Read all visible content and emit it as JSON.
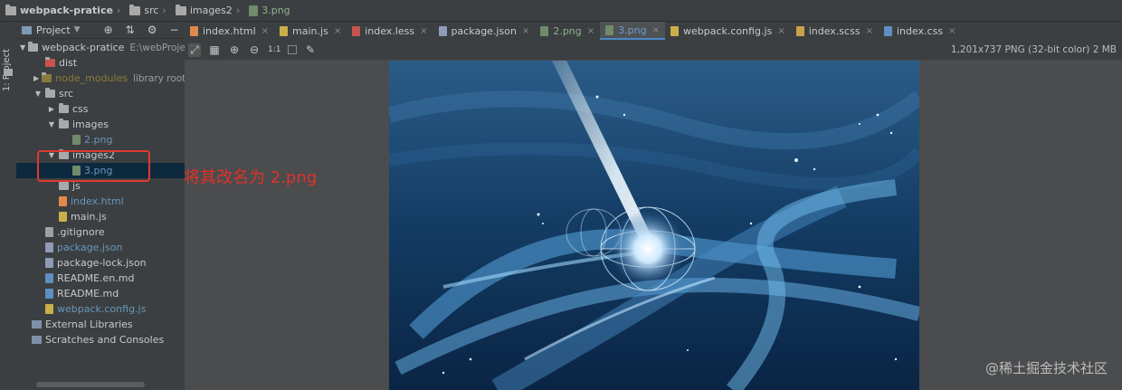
{
  "breadcrumb": [
    {
      "icon": "folder-icon",
      "label": "webpack-pratice"
    },
    {
      "icon": "folder-icon",
      "label": "src"
    },
    {
      "icon": "folder-icon",
      "label": "images2"
    },
    {
      "icon": "png-file-icon",
      "label": "3.png"
    }
  ],
  "project_panel": {
    "title": "Project",
    "strip_label": "1: Project"
  },
  "tree": [
    {
      "indent": 0,
      "arrow": "▼",
      "icon": "folder",
      "label": "webpack-pratice",
      "extra": "E:\\webProject\\"
    },
    {
      "indent": 1,
      "arrow": "",
      "icon": "folder-red",
      "label": "dist"
    },
    {
      "indent": 1,
      "arrow": "▶",
      "icon": "folder-olive",
      "label": "node_modules",
      "extra": "library root"
    },
    {
      "indent": 1,
      "arrow": "▼",
      "icon": "folder",
      "label": "src"
    },
    {
      "indent": 2,
      "arrow": "▶",
      "icon": "folder",
      "label": "css"
    },
    {
      "indent": 2,
      "arrow": "▼",
      "icon": "folder",
      "label": "images"
    },
    {
      "indent": 3,
      "arrow": "",
      "icon": "png",
      "label": "2.png"
    },
    {
      "indent": 2,
      "arrow": "▼",
      "icon": "folder",
      "label": "images2"
    },
    {
      "indent": 3,
      "arrow": "",
      "icon": "png",
      "label": "3.png",
      "selected": true
    },
    {
      "indent": 2,
      "arrow": "",
      "icon": "folder",
      "label": "js"
    },
    {
      "indent": 2,
      "arrow": "",
      "icon": "html",
      "label": "index.html"
    },
    {
      "indent": 2,
      "arrow": "",
      "icon": "js",
      "label": "main.js"
    },
    {
      "indent": 1,
      "arrow": "",
      "icon": "git",
      "label": ".gitignore"
    },
    {
      "indent": 1,
      "arrow": "",
      "icon": "json",
      "label": "package.json"
    },
    {
      "indent": 1,
      "arrow": "",
      "icon": "json",
      "label": "package-lock.json"
    },
    {
      "indent": 1,
      "arrow": "",
      "icon": "md",
      "label": "README.en.md"
    },
    {
      "indent": 1,
      "arrow": "",
      "icon": "md",
      "label": "README.md"
    },
    {
      "indent": 1,
      "arrow": "",
      "icon": "js",
      "label": "webpack.config.js"
    },
    {
      "indent": 0,
      "arrow": "",
      "icon": "lib",
      "label": "External Libraries"
    },
    {
      "indent": 0,
      "arrow": "",
      "icon": "lib",
      "label": "Scratches and Consoles"
    }
  ],
  "tabs": [
    {
      "label": "index.html",
      "icon": "html"
    },
    {
      "label": "main.js",
      "icon": "js"
    },
    {
      "label": "index.less",
      "icon": "less"
    },
    {
      "label": "package.json",
      "icon": "json"
    },
    {
      "label": "2.png",
      "icon": "png"
    },
    {
      "label": "3.png",
      "icon": "png",
      "active": true
    },
    {
      "label": "webpack.config.js",
      "icon": "js"
    },
    {
      "label": "index.scss",
      "icon": "scss"
    },
    {
      "label": "index.css",
      "icon": "css"
    }
  ],
  "image_info": "1,201x737 PNG (32-bit color) 2 MB",
  "annotation": "将其改名为 2.png",
  "watermark": "@稀土掘金技术社区",
  "colors": {
    "accent": "#4a88c7",
    "annotation_red": "#e0322a",
    "selection": "#0d293e"
  }
}
